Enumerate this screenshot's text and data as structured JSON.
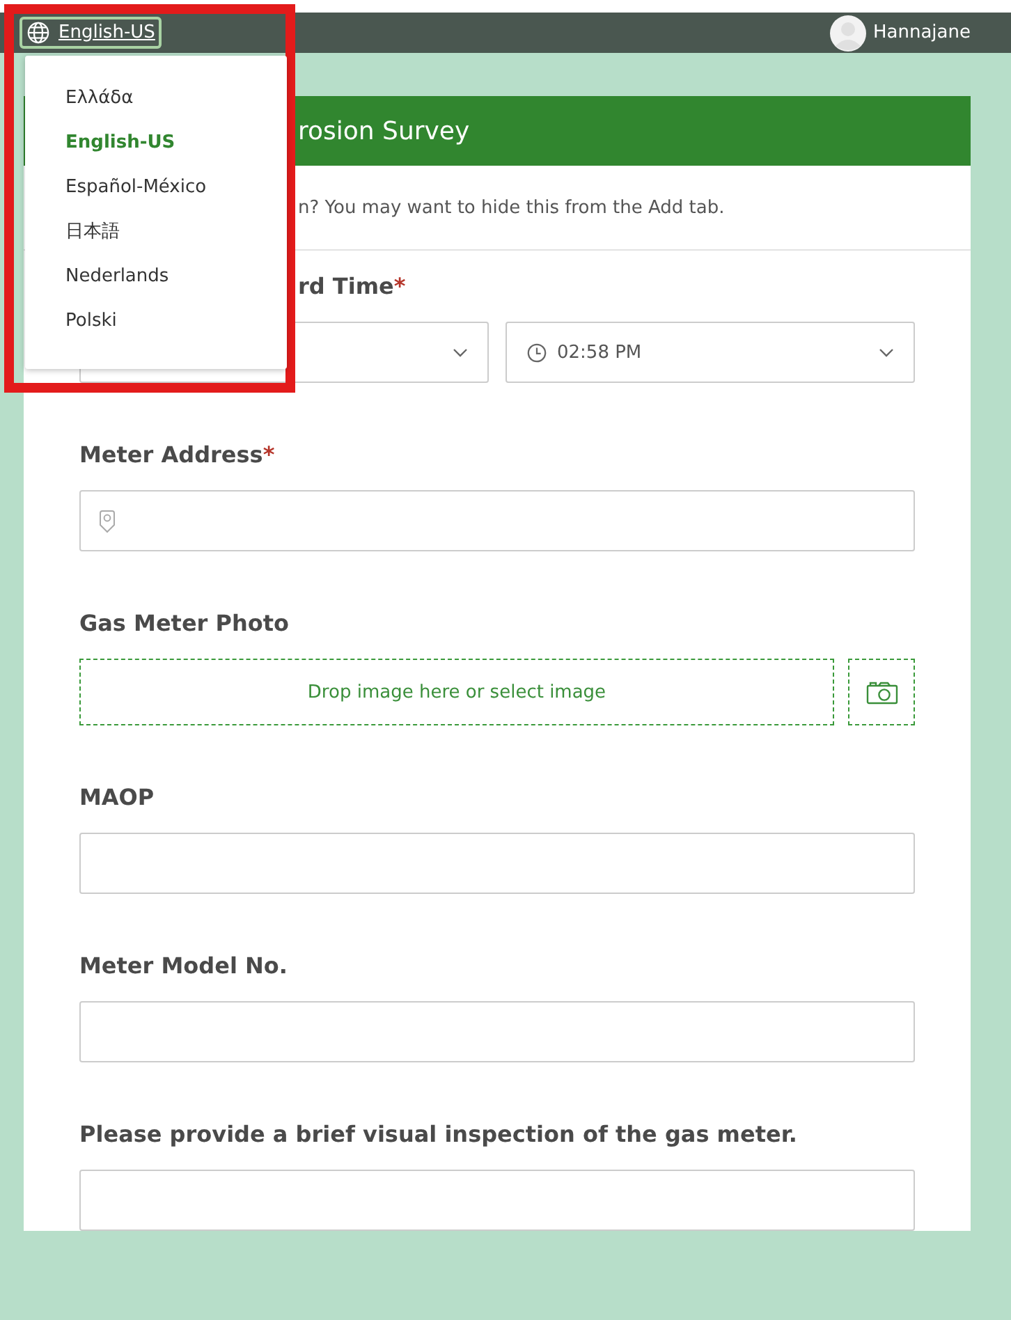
{
  "top_bar": {
    "language": "English-US",
    "user": "Hannajane"
  },
  "language_menu": {
    "items": [
      {
        "label": "Ελλάδα",
        "selected": false
      },
      {
        "label": "English-US",
        "selected": true
      },
      {
        "label": "Español-México",
        "selected": false
      },
      {
        "label": "日本語",
        "selected": false
      },
      {
        "label": "Nederlands",
        "selected": false
      },
      {
        "label": "Polski",
        "selected": false
      }
    ]
  },
  "form": {
    "required_marker": "*",
    "title": "rosion Survey",
    "description": "n? You may want to hide this from the Add tab.",
    "fields": [
      {
        "kind": "datetime",
        "label": "rd Time",
        "required": true,
        "time": "02:58 PM"
      },
      {
        "kind": "address",
        "label": "Meter Address",
        "required": true
      },
      {
        "kind": "image",
        "label": "Gas Meter Photo",
        "required": false,
        "drop_text": "Drop image here or select image"
      },
      {
        "kind": "text",
        "label": "MAOP",
        "required": false
      },
      {
        "kind": "text",
        "label": "Meter Model No.",
        "required": false
      },
      {
        "kind": "text",
        "label": "Please provide a brief visual inspection of the gas meter.",
        "required": false
      }
    ]
  }
}
